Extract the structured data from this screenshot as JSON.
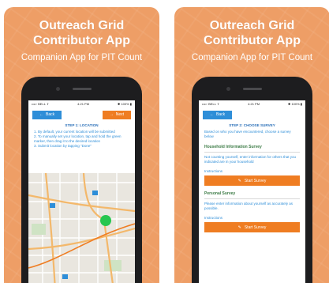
{
  "hero": {
    "title_line1": "Outreach Grid",
    "title_line2": "Contributor App",
    "subtitle": "Companion App for PIT Count"
  },
  "status_bar": {
    "carrier": "••••◦ BELL ⇧",
    "time": "4:21 PM",
    "battery": "✱ 100% ▮"
  },
  "screen1": {
    "back_label": "Back",
    "next_label": "Next",
    "step_title": "STEP 1: LOCATION",
    "instructions": [
      "1. By default, your current location will be submitted",
      "2. To manually set your location, tap and hold the green marker, then drag it to the desired location",
      "3. Submit location by tapping \"Done\""
    ]
  },
  "screen2": {
    "back_label": "Back",
    "step_title": "STEP 2: CHOOSE SURVEY",
    "intro": "Based on who you have encountered, choose a survey below",
    "household": {
      "title": "Household Information Survey",
      "description": "Not counting yourself, enter information for others that you indicated are in your household",
      "instructions_label": "Instructions",
      "button_label": "Start Survey"
    },
    "personal": {
      "title": "Personal Survey",
      "description": "Please enter information about yourself as accurately as possible.",
      "instructions_label": "Instructions",
      "button_label": "Start Survey"
    }
  },
  "colors": {
    "panel_orange": "#ee9e66",
    "button_blue": "#2e8ed8",
    "button_orange": "#ef7d22",
    "section_green": "#3a7a44",
    "marker_green": "#27c64f"
  }
}
